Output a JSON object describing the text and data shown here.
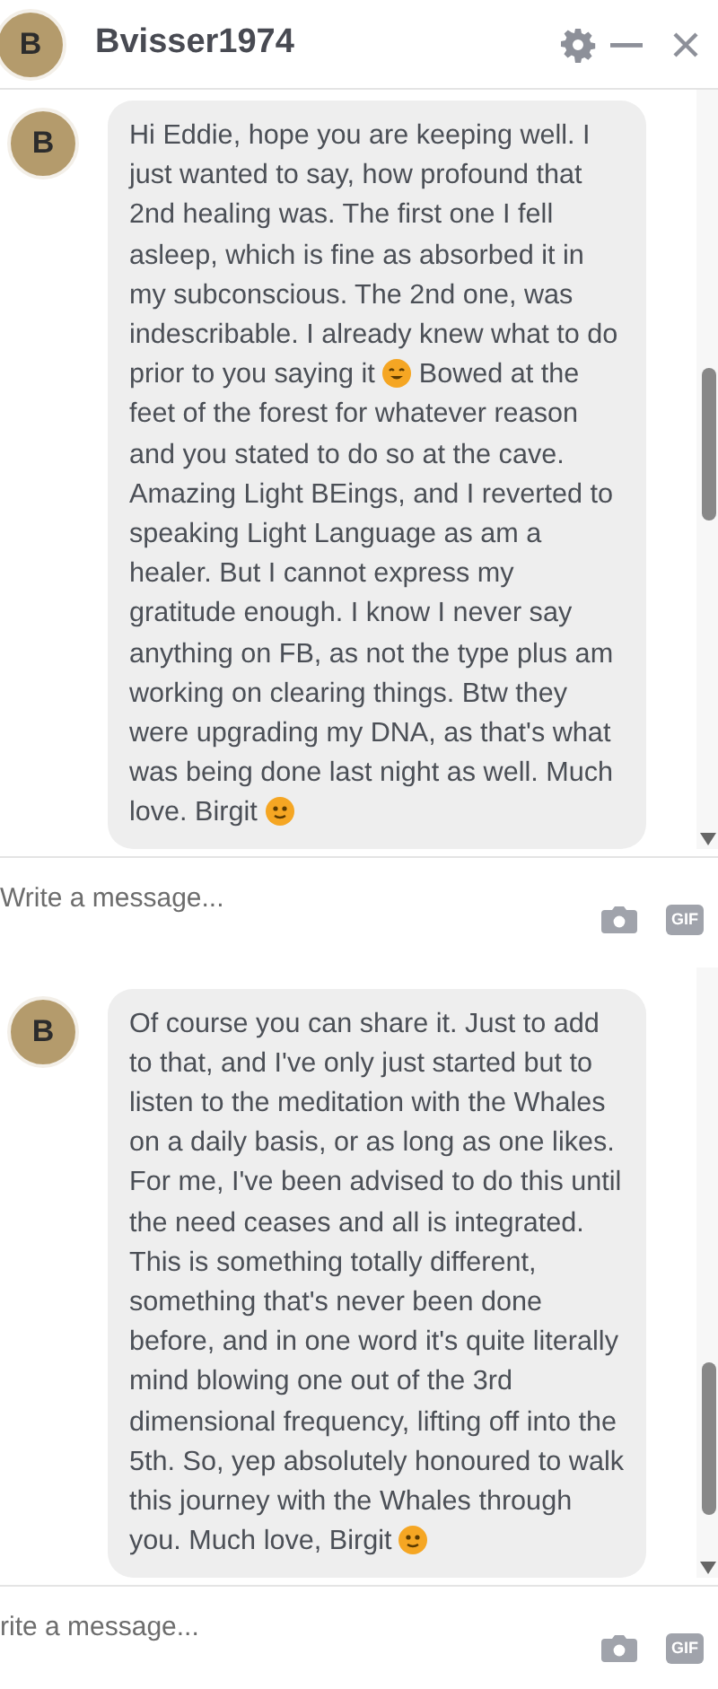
{
  "header": {
    "avatar_letter": "B",
    "title": "Bvisser1974"
  },
  "panels": [
    {
      "avatar_letter": "B",
      "message": [
        {
          "kind": "text",
          "text": "Hi Eddie, hope you are keeping well. I just wanted to say, how profound that 2nd healing was. The first one I fell asleep, which is fine as absorbed it in my subconscious. The 2nd one, was indescribable. I already knew what to do prior to you saying it "
        },
        {
          "kind": "grin"
        },
        {
          "kind": "text",
          "text": " Bowed at the feet of the forest for whatever reason and you stated to do so at the cave. Amazing Light BEings, and I reverted to speaking Light Language as am a healer. But I cannot express my gratitude enough. I know I never say anything on FB, as not the type plus am working on clearing things. Btw they were upgrading my DNA, as that's what was being done last night as well. Much love. Birgit "
        },
        {
          "kind": "smile"
        }
      ],
      "input": {
        "placeholder": "Write a message..."
      },
      "gif": "GIF"
    },
    {
      "avatar_letter": "B",
      "message": [
        {
          "kind": "text",
          "text": "Of course you can share it. Just to add to that, and I've only just started but to listen to the meditation with the Whales on a daily basis, or as long as one likes. For me, I've been advised to do this until the need ceases and all is integrated. This is something totally different, something that's never been done before, and in one word it's quite literally mind blowing one out of the 3rd dimensional frequency, lifting off into the 5th. So, yep absolutely honoured to walk this journey with the Whales through you. Much love, Birgit "
        },
        {
          "kind": "smile"
        }
      ],
      "input": {
        "placeholder": "rite a message..."
      },
      "gif": "GIF"
    }
  ]
}
